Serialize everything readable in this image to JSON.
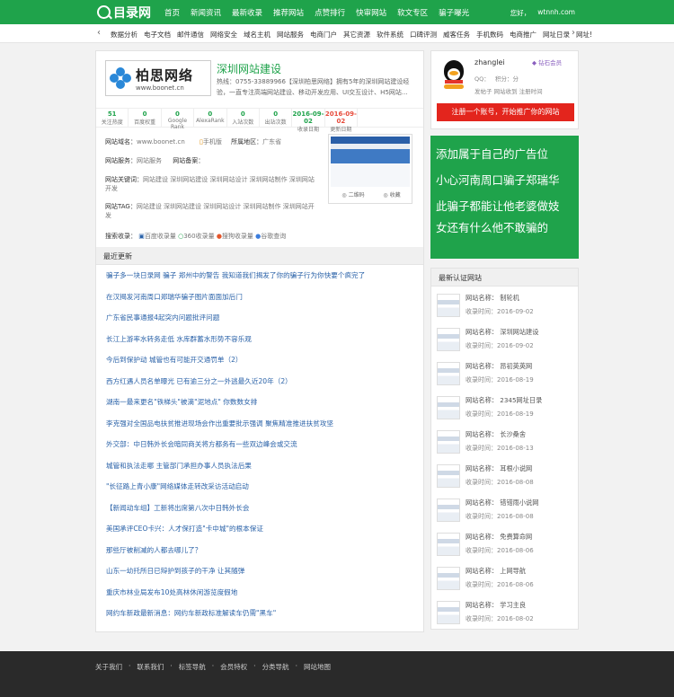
{
  "header": {
    "logo_text": "目录网",
    "nav": [
      "首页",
      "新闻资讯",
      "最新收录",
      "推荐网站",
      "点赞排行",
      "快审网站",
      "软文专区",
      "骗子曝光"
    ],
    "greeting": "您好，",
    "user_link": "wtnnh.com"
  },
  "categories": {
    "items": [
      "数据分析",
      "电子文档",
      "邮件通信",
      "网络安全",
      "域名主机",
      "网站服务",
      "电商门户",
      "其它资源",
      "软件系统",
      "口碑评测",
      "威客任务",
      "手机数码",
      "电商推广",
      "网址日录",
      "网址!"
    ]
  },
  "site": {
    "logo_name": "柏思网络",
    "logo_url": "www.boonet.cn",
    "title": "深圳网站建设",
    "desc": "热线：0755-33889966【深圳柏思网络】拥有5年的深圳网站建设经验，一直专注高端网站建设、移动开发应用、UI交互设计、H5网站...",
    "stats": [
      {
        "value": "51",
        "label": "关注热度",
        "red": false
      },
      {
        "value": "0",
        "label": "百度权重",
        "red": false
      },
      {
        "value": "0",
        "label": "Google Rank",
        "red": false
      },
      {
        "value": "0",
        "label": "AlexaRank",
        "red": false
      },
      {
        "value": "0",
        "label": "入站次数",
        "red": false
      },
      {
        "value": "0",
        "label": "出站次数",
        "red": false
      },
      {
        "value": "2016-09-02",
        "label": "收录日期",
        "red": false
      },
      {
        "value": "2016-09-02",
        "label": "更新日期",
        "red": true
      }
    ],
    "url_label": "网站域名：",
    "url_value": "www.boonet.cn",
    "mobile_label": "手机版",
    "region_label": "所属地区：",
    "region_value": "广东省",
    "service_label": "网站服务：",
    "service_value": "网站服务",
    "record_label": "网站备案：",
    "record_value": "",
    "keywords_label": "网站关键词：",
    "keywords_value": "网站建设 深圳网站建设 深圳网站设计 深圳网站制作 深圳网站开发",
    "tags_label": "网站TAG：",
    "tags_value": "网站建设 深圳网站建设 深圳网站设计 深圳网站制作 深圳网站开发",
    "search_label": "搜索收录：",
    "search_items": [
      "百度收录量",
      "360收录量",
      "搜狗收录量",
      "谷歌查询"
    ],
    "shot_btns": [
      "二维码",
      "收藏"
    ]
  },
  "news": {
    "header": "最近更新",
    "items": [
      "骗子多一块日录网 骗子 郑州中的警告 我知道我们揭发了你的骗子行为你快要个疯完了",
      "在汉揭发河南周口郑瑞华骗子图片面面加后门",
      "广东省民事通报4起突内问题批评问题",
      "长江上游率水转务走低 水库群蓄水形势不容乐观",
      "今后到保护动 城管也有可能开交通罚单（2）",
      "西方红遇人员名单曝光 已有逾三分之一外逃最久近20年（2）",
      "湖南一最来更名\"铁梯头\"被滴\"泥地点\" 你数数女排",
      "李克强对全国品电扶贫推进现场会作出重要批示强调 聚焦精准推进扶贫攻坚",
      "外交部：中日韩外长会暗同商关将方都务有一些双边峰会或交流",
      "城管和执法走哪 主管部门承担办事人员执法后果",
      "\"长征路上青小康\"网络媒体走转改采访活动启动",
      "【新闻动车组】工新将出席第八次中日韩外长会",
      "美国承评CEO卡兴：人才保打造\"卡中城\"的根本保证",
      "那些厅被削减的人都去哪儿了？",
      "山东一幼托所日已辩护到孩子的干净 让其随弹",
      "重庆市林业局发布10处高林休闲游览度假地",
      "网约车新政最新消息：网约车新政标准解读车仍需\"黑车\""
    ]
  },
  "user": {
    "name": "zhanglei",
    "badge": "钻石会员",
    "qq": "QQ：",
    "points": "积分：分",
    "links": "发帖子  网站收到  注册时间",
    "button": "注册一个账号，开始推广你的网站"
  },
  "ad": {
    "lines": [
      "添加属于自己的广告位",
      "小心河南周口骗子郑瑞华",
      "此骗子都能让他老婆做妓",
      "女还有什么他不敢骗的"
    ]
  },
  "recent": {
    "header": "最新认证网站",
    "name_label": "网站名称：",
    "date_label": "收录时间：",
    "items": [
      {
        "name": "制轮机",
        "date": "2016-09-02"
      },
      {
        "name": "深圳网站建设",
        "date": "2016-09-02"
      },
      {
        "name": "昂初英英网",
        "date": "2016-08-19"
      },
      {
        "name": "2345网址日录",
        "date": "2016-08-19"
      },
      {
        "name": "长沙桑舍",
        "date": "2016-08-13"
      },
      {
        "name": "耳根小说网",
        "date": "2016-08-08"
      },
      {
        "name": "错错雨小说网",
        "date": "2016-08-08"
      },
      {
        "name": "免费算命网",
        "date": "2016-08-06"
      },
      {
        "name": "上网导航",
        "date": "2016-08-06"
      },
      {
        "name": "学习主良",
        "date": "2016-08-02"
      }
    ]
  },
  "footer": {
    "links": [
      "关于我们",
      "·",
      "联系我们",
      "·",
      "标签导航",
      "·",
      "会员特权",
      "·",
      "分类导航",
      "·",
      "网站地图"
    ]
  }
}
